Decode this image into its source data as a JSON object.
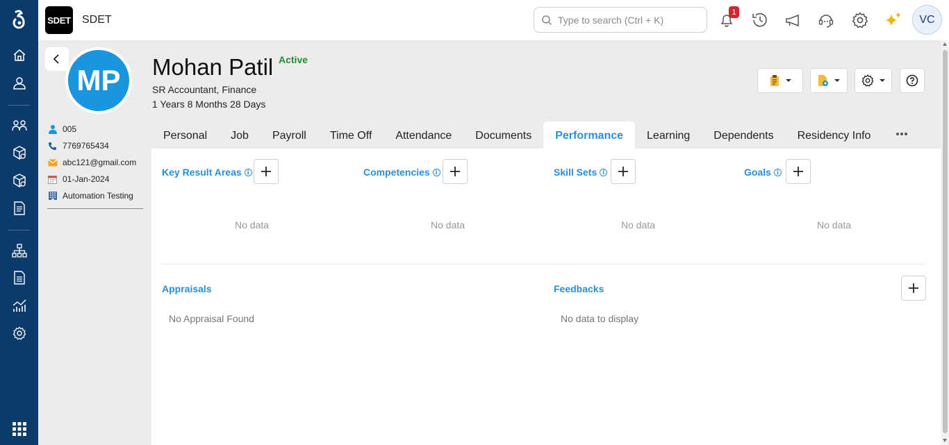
{
  "app": {
    "logo": "SDET",
    "title": "SDET"
  },
  "search": {
    "placeholder": "Type to search (Ctrl + K)"
  },
  "notifications": {
    "count": "1"
  },
  "user": {
    "initials": "VC"
  },
  "employee": {
    "initials": "MP",
    "name": "Mohan Patil",
    "status": "Active",
    "role": "SR Accountant, Finance",
    "tenure": "1 Years 8 Months 28 Days",
    "id": "005",
    "phone": "7769765434",
    "email": "abc121@gmail.com",
    "join_date": "01-Jan-2024",
    "department": "Automation Testing"
  },
  "tabs": [
    "Personal",
    "Job",
    "Payroll",
    "Time Off",
    "Attendance",
    "Documents",
    "Performance",
    "Learning",
    "Dependents",
    "Residency Info"
  ],
  "active_tab": "Performance",
  "sections": {
    "kra": {
      "title": "Key Result Areas",
      "empty": "No data"
    },
    "competencies": {
      "title": "Competencies",
      "empty": "No data"
    },
    "skillsets": {
      "title": "Skill Sets",
      "empty": "No data"
    },
    "goals": {
      "title": "Goals",
      "empty": "No data"
    },
    "appraisals": {
      "title": "Appraisals",
      "empty": "No Appraisal Found"
    },
    "feedbacks": {
      "title": "Feedbacks",
      "empty": "No data to display"
    }
  },
  "colors": {
    "nav": "#0b3a6b",
    "accent": "#2b8fd6",
    "avatar": "#1a95e0",
    "status": "#1f8f2a",
    "badge": "#d9232e"
  }
}
